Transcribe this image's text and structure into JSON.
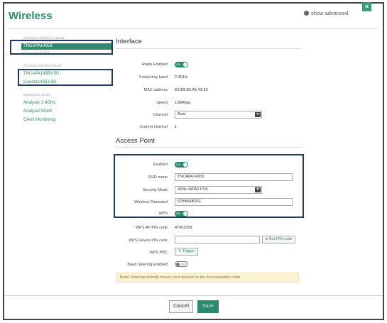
{
  "header": {
    "title": "Wireless",
    "show_advanced": "show advanced",
    "close": "×"
  },
  "sidebar": {
    "section_24": "ACCESS POINTS 2.4GHZ",
    "items_24": [
      "TNCAPA14953",
      "GuestA14953"
    ],
    "section_5": "ACCESS POINTS 5GHZ",
    "items_5": [
      "TNCAPA14953-5G",
      "GuestA14953-5G"
    ],
    "section_data": "WIRELESS DATA",
    "items_data": [
      "Analyzer 2.4GHz",
      "Analyzer 5GHz",
      "Client Monitoring"
    ]
  },
  "interface": {
    "title": "Interface",
    "radio_enabled_label": "Radio Enabled",
    "radio_enabled_state": "ON",
    "frequency_band_label": "Frequency band",
    "frequency_band": "2.4GHz",
    "mac_address_label": "MAC address",
    "mac_address": "E0:B9:E5:A1:49:53",
    "speed_label": "Speed",
    "speed": "130Mbps",
    "channel_label": "Channel",
    "channel": "Auto",
    "current_channel_label": "Current channel",
    "current_channel": "1"
  },
  "access_point": {
    "title": "Access Point",
    "enabled_label": "Enabled",
    "enabled_state": "ON",
    "ssid_label": "SSID name",
    "ssid": "TNCAPA14953",
    "security_mode_label": "Security Mode",
    "security_mode": "WPA+WPA2 PSK",
    "password_label": "Wireless Password",
    "password": "6299BAB25E",
    "wps_label": "WPS",
    "wps_state": "ON",
    "wps_ap_pin_label": "WPS AP PIN code",
    "wps_ap_pin": "47602359",
    "wps_device_pin_label": "WPS Device PIN code",
    "wps_device_pin": "",
    "set_pin_button": "Set PIN code",
    "wps_pbc_label": "WPS PBC",
    "trigger_button": "Trigger",
    "band_steering_label": "Band Steering Enabled",
    "band_steering_state": "OFF",
    "notice": "Band Steering actively moves your devices to the best available radio."
  },
  "footer": {
    "cancel": "Cancel",
    "save": "Save"
  }
}
